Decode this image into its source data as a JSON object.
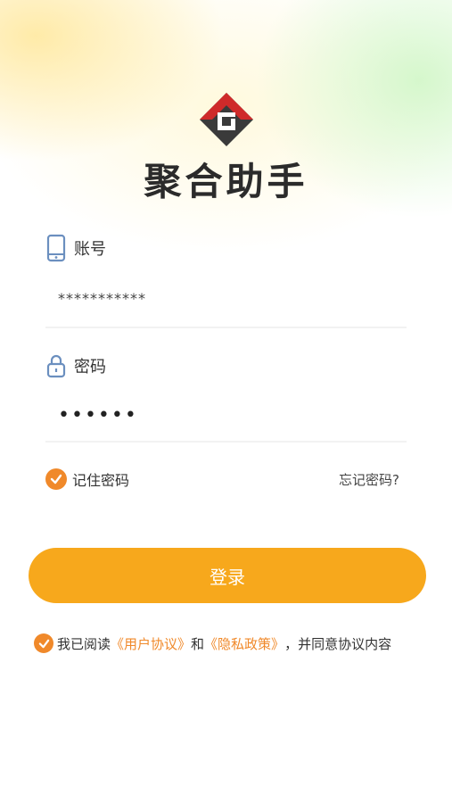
{
  "app": {
    "name": "聚合助手"
  },
  "account": {
    "label": "账号",
    "value": "***********"
  },
  "password": {
    "label": "密码",
    "value": "••••••"
  },
  "remember": {
    "label": "记住密码",
    "checked": true
  },
  "forgot": {
    "label": "忘记密码?"
  },
  "login": {
    "label": "登录"
  },
  "agreement": {
    "checked": true,
    "prefix": "我已阅读",
    "user_link": "《用户协议》",
    "and": "和",
    "privacy_link": "《隐私政策》",
    "suffix": "，并同意协议内容"
  },
  "colors": {
    "accent": "#f7a81c",
    "check": "#f0892a",
    "logo_red": "#cf2a2a",
    "logo_dark": "#3a3a3a",
    "icon_blue": "#6b8fbf"
  }
}
